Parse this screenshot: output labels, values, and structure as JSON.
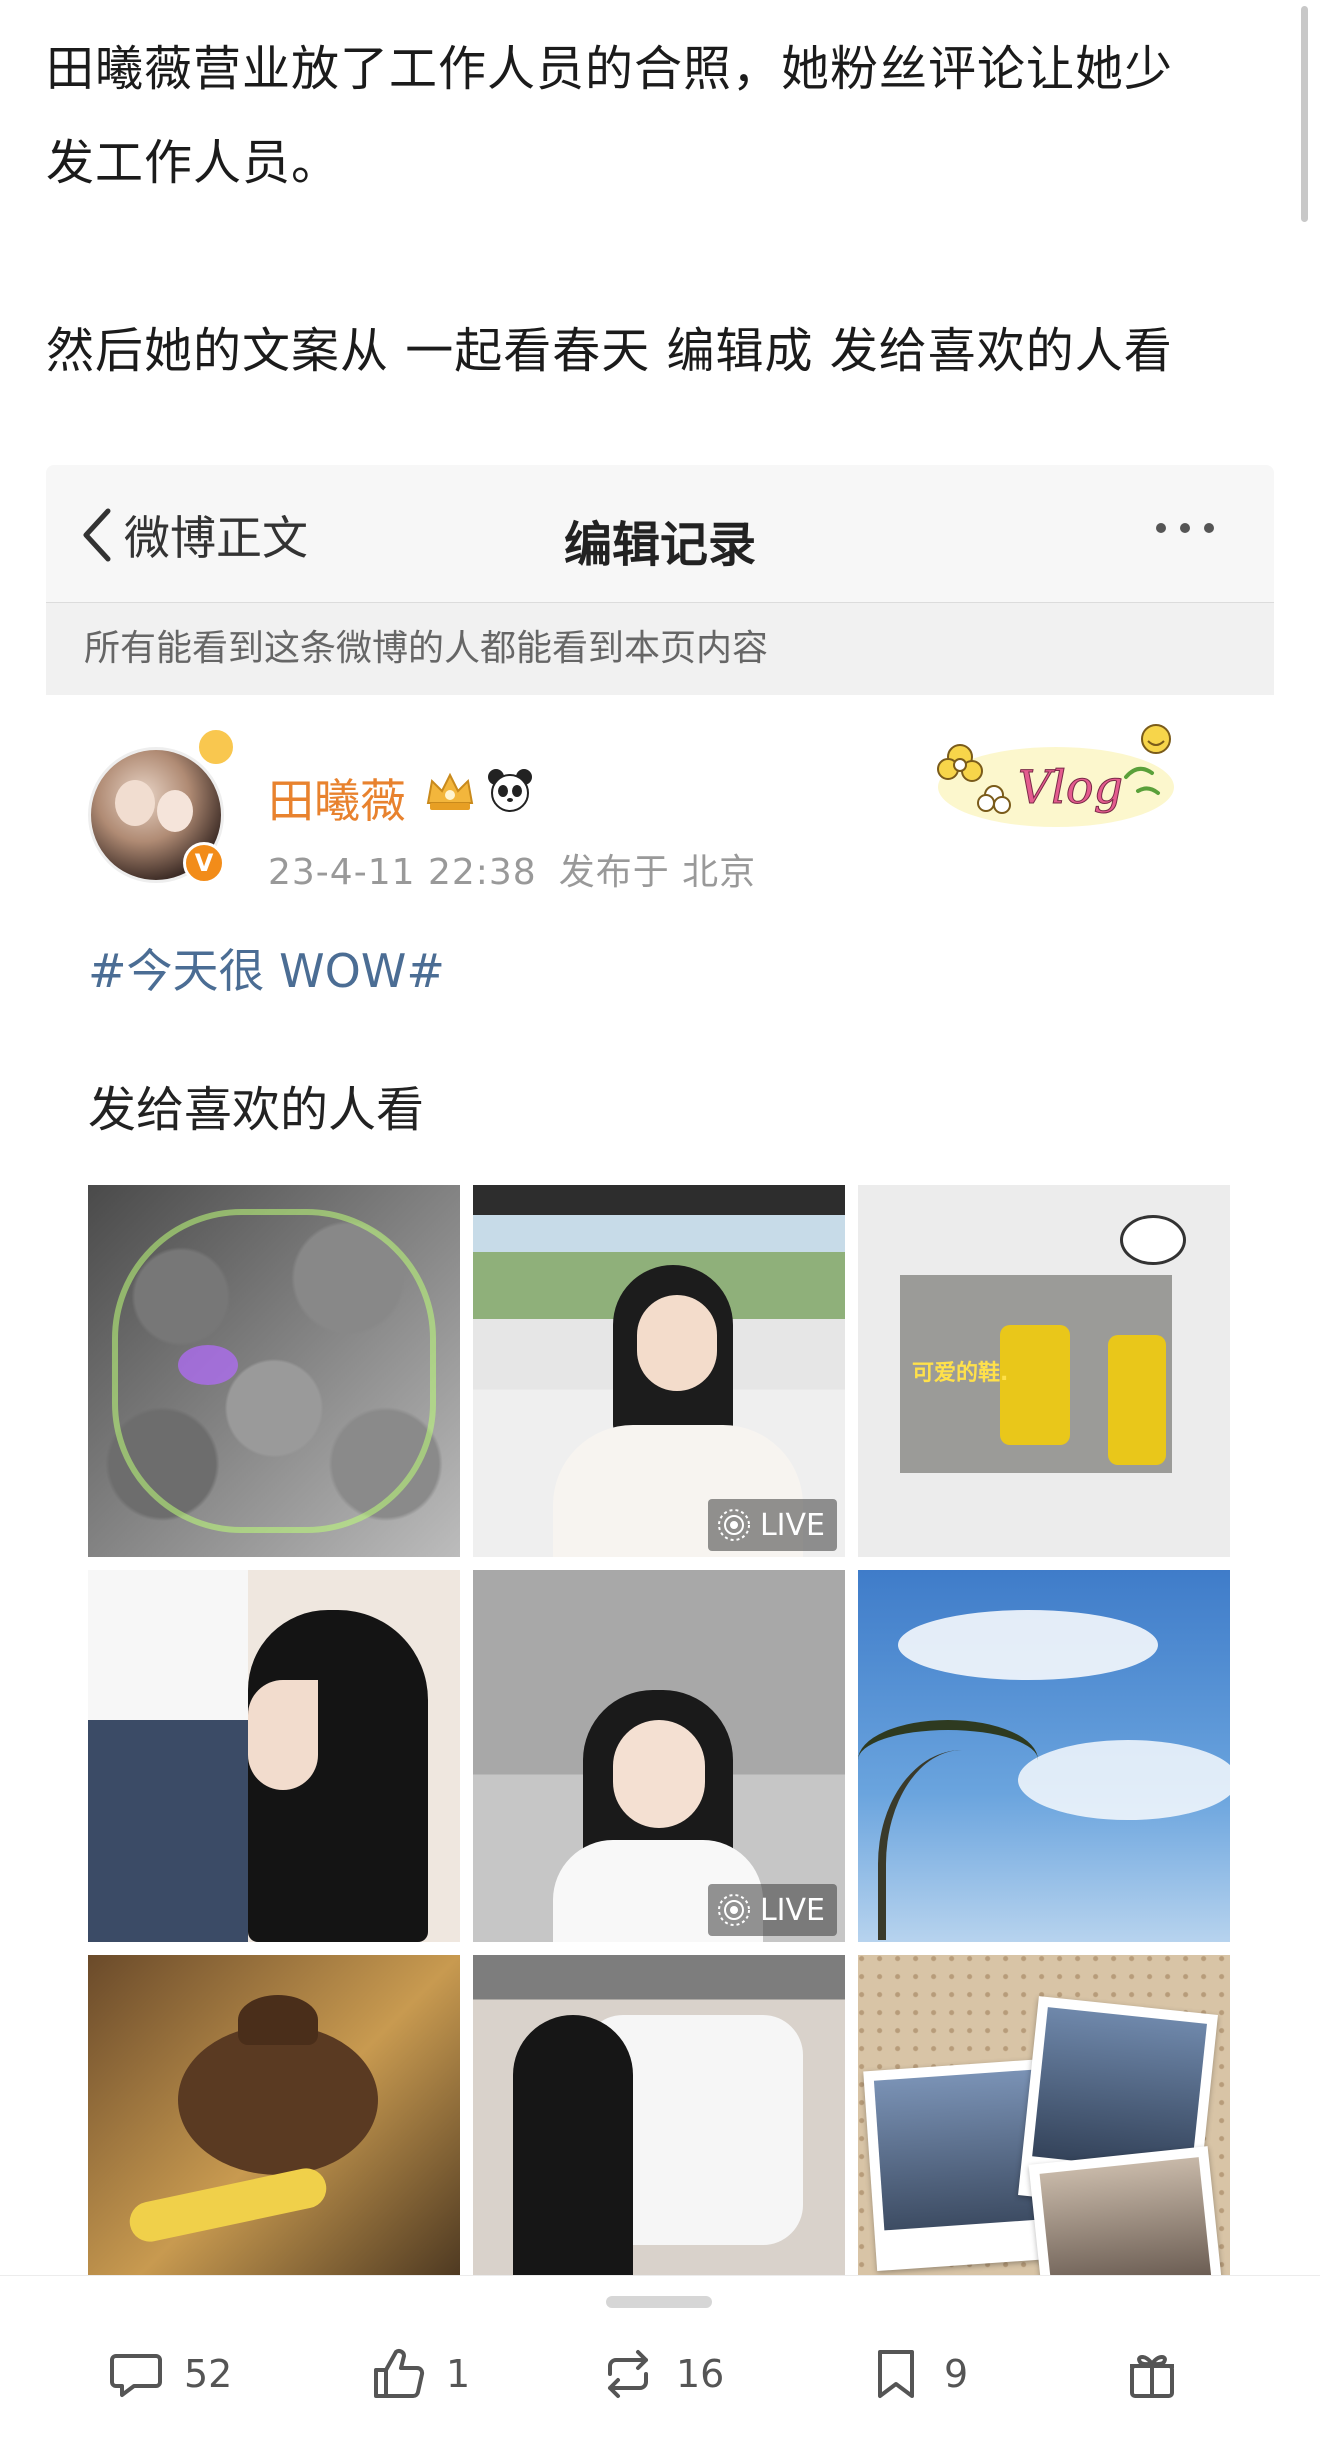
{
  "intro": {
    "line1": "田曦薇营业放了工作人员的合照，她粉丝评论让她少",
    "line2": "发工作人员。",
    "line3": "然后她的文案从  一起看春天 编辑成  发给喜欢的人看"
  },
  "screenshot": {
    "nav": {
      "back_label": "微博正文",
      "title": "编辑记录"
    },
    "notice": "所有能看到这条微博的人都能看到本页内容",
    "user": {
      "name": "田曦薇",
      "verify_badge": "V"
    },
    "meta": {
      "time": "23-4-11 22:38",
      "location": "发布于 北京"
    },
    "sticker_text": "Vlog",
    "topic": "#今天很 WOW#",
    "post_text": "发给喜欢的人看",
    "photos": [
      {
        "desc": "group-photo-collage",
        "live": ""
      },
      {
        "desc": "girl-in-car",
        "live": "LIVE"
      },
      {
        "desc": "yellow-boots",
        "live": "",
        "caption": "可爱的鞋."
      },
      {
        "desc": "hair-styling",
        "live": ""
      },
      {
        "desc": "girl-smiling",
        "live": "LIVE"
      },
      {
        "desc": "sky-palm-tree",
        "live": ""
      },
      {
        "desc": "bbq-food",
        "live": ""
      },
      {
        "desc": "girl-in-car-back",
        "live": ""
      },
      {
        "desc": "polaroid-photos",
        "live": ""
      }
    ]
  },
  "actions": {
    "comments": "52",
    "likes": "1",
    "reposts": "16",
    "favorites": "9"
  },
  "colors": {
    "username": "#e8822e",
    "topic": "#4b6d94",
    "verify": "#f28c19"
  }
}
